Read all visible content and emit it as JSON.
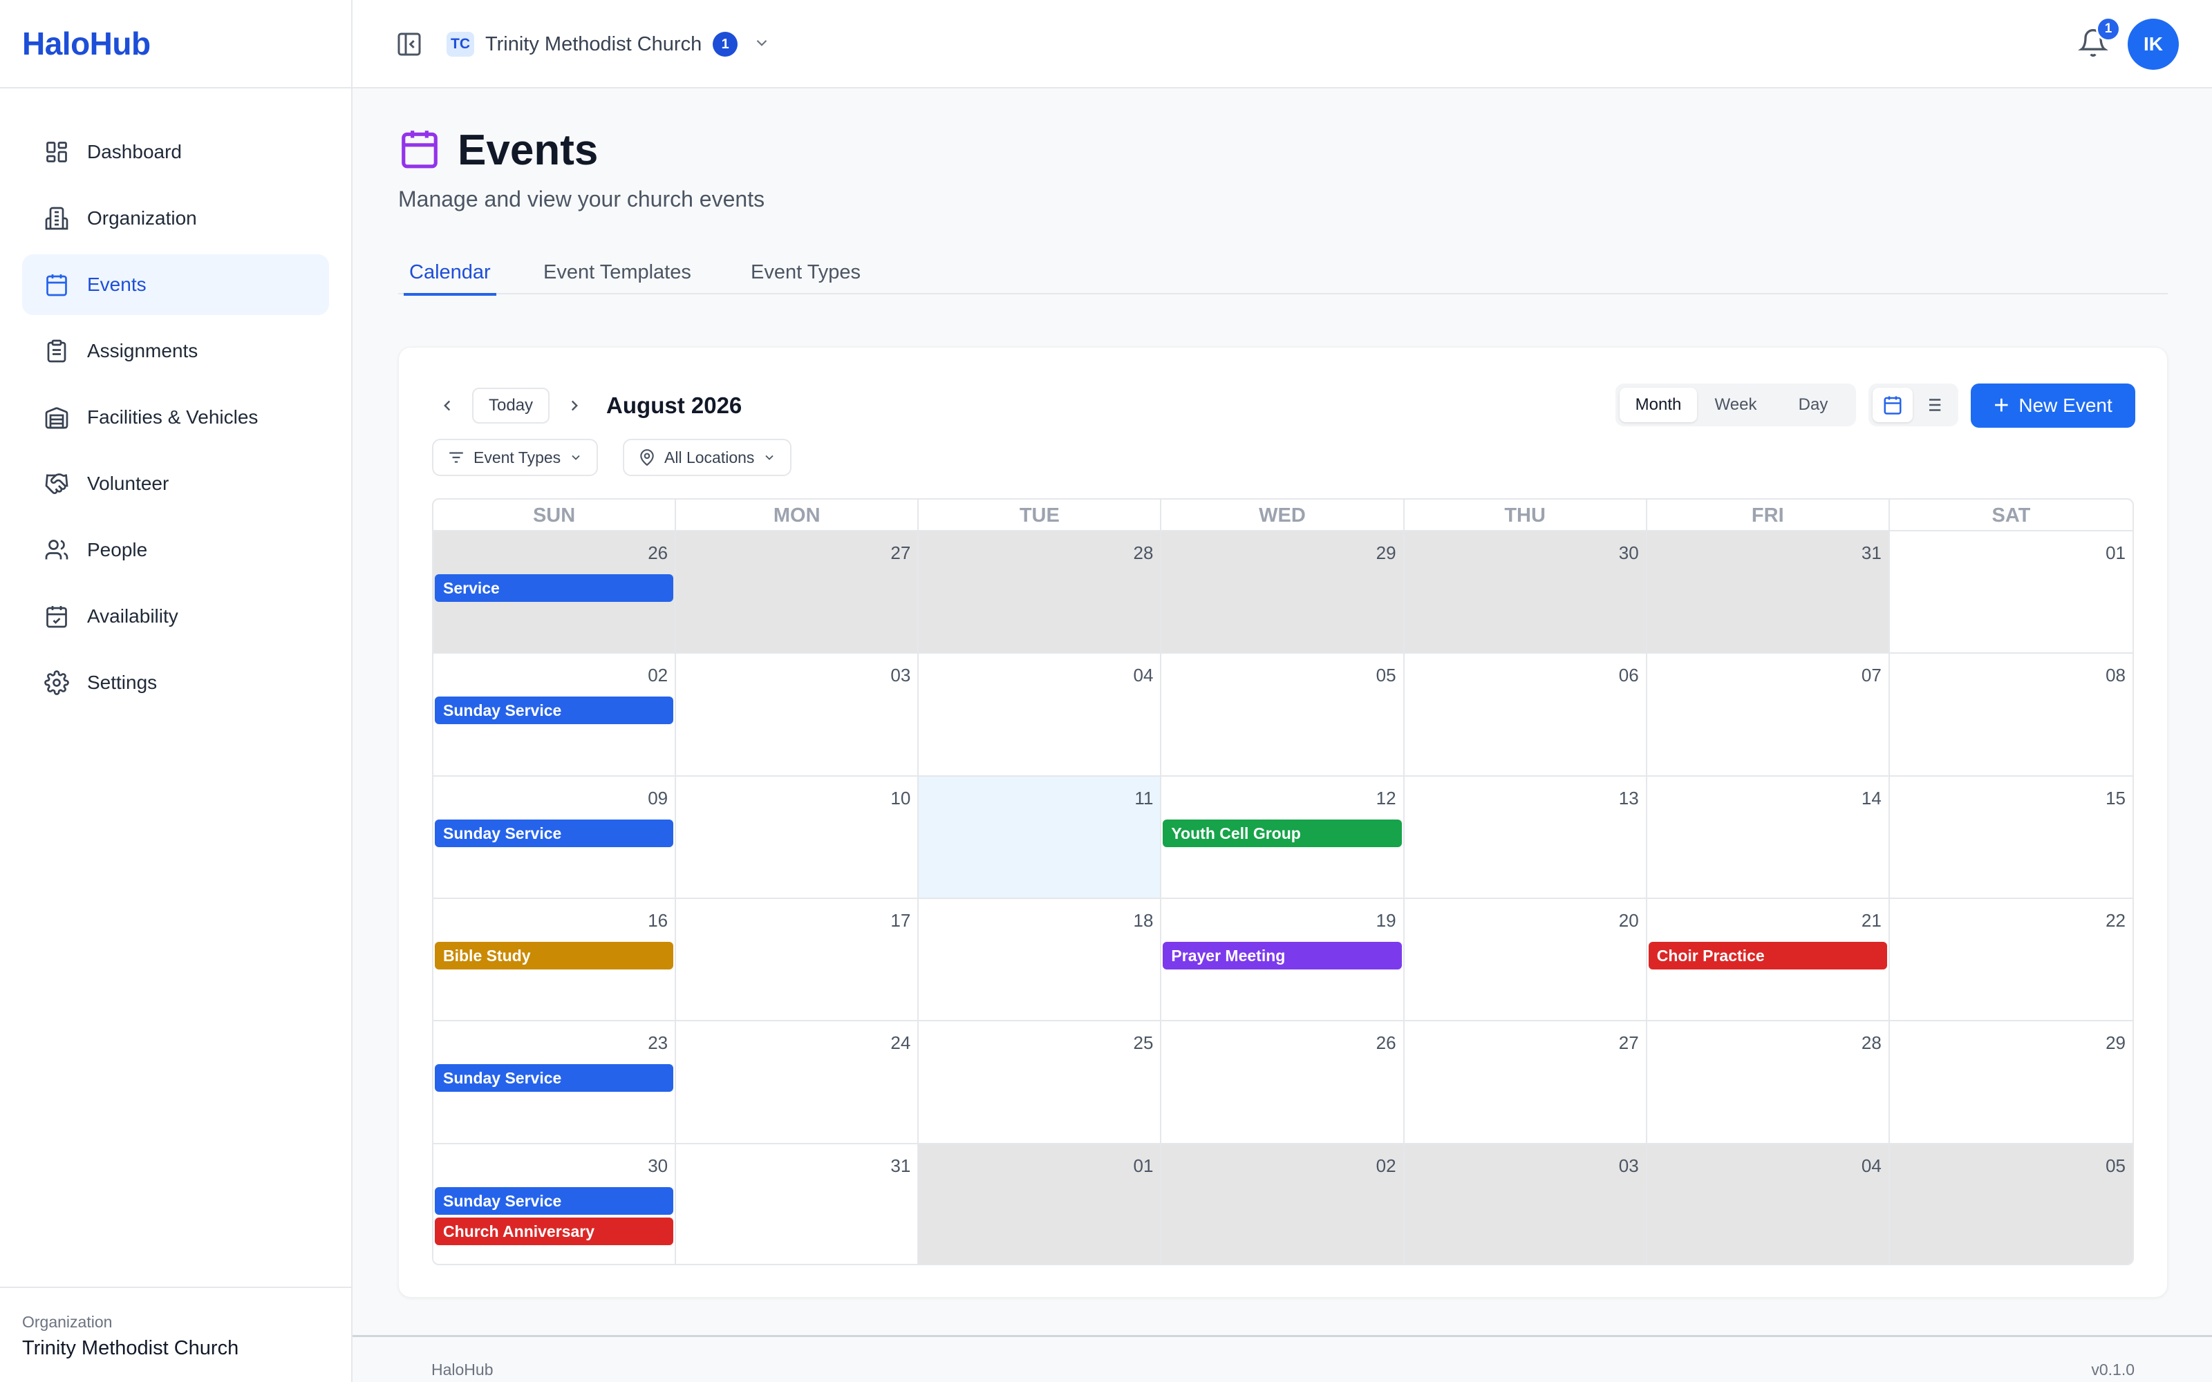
{
  "app": {
    "logo": "HaloHub"
  },
  "sidebar": {
    "items": [
      {
        "label": "Dashboard",
        "icon": "dashboard-icon"
      },
      {
        "label": "Organization",
        "icon": "building-icon"
      },
      {
        "label": "Events",
        "icon": "calendar-icon"
      },
      {
        "label": "Assignments",
        "icon": "clipboard-icon"
      },
      {
        "label": "Facilities & Vehicles",
        "icon": "warehouse-icon"
      },
      {
        "label": "Volunteer",
        "icon": "handshake-icon"
      },
      {
        "label": "People",
        "icon": "users-icon"
      },
      {
        "label": "Availability",
        "icon": "calendar-check-icon"
      },
      {
        "label": "Settings",
        "icon": "gear-icon"
      }
    ],
    "active_index": 2,
    "footer": {
      "label": "Organization",
      "value": "Trinity Methodist Church"
    }
  },
  "topbar": {
    "org_abbr": "TC",
    "org_name": "Trinity Methodist Church",
    "org_count": "1",
    "notification_count": "1",
    "avatar_initials": "IK"
  },
  "page": {
    "title": "Events",
    "subtitle": "Manage and view your church events",
    "tabs": [
      "Calendar",
      "Event Templates",
      "Event Types"
    ],
    "active_tab": 0
  },
  "calendar": {
    "today_label": "Today",
    "month_label": "August 2026",
    "views": [
      "Month",
      "Week",
      "Day"
    ],
    "active_view": "Month",
    "new_event_label": "New Event",
    "filters": {
      "event_types": "Event Types",
      "locations": "All Locations"
    },
    "weekdays": [
      "SUN",
      "MON",
      "TUE",
      "WED",
      "THU",
      "FRI",
      "SAT"
    ],
    "days": [
      {
        "n": "26",
        "other": true
      },
      {
        "n": "27",
        "other": true
      },
      {
        "n": "28",
        "other": true
      },
      {
        "n": "29",
        "other": true
      },
      {
        "n": "30",
        "other": true
      },
      {
        "n": "31",
        "other": true
      },
      {
        "n": "01",
        "other": false
      },
      {
        "n": "02",
        "other": false
      },
      {
        "n": "03",
        "other": false
      },
      {
        "n": "04",
        "other": false
      },
      {
        "n": "05",
        "other": false
      },
      {
        "n": "06",
        "other": false
      },
      {
        "n": "07",
        "other": false
      },
      {
        "n": "08",
        "other": false
      },
      {
        "n": "09",
        "other": false
      },
      {
        "n": "10",
        "other": false
      },
      {
        "n": "11",
        "other": false,
        "today": true
      },
      {
        "n": "12",
        "other": false
      },
      {
        "n": "13",
        "other": false
      },
      {
        "n": "14",
        "other": false
      },
      {
        "n": "15",
        "other": false
      },
      {
        "n": "16",
        "other": false
      },
      {
        "n": "17",
        "other": false
      },
      {
        "n": "18",
        "other": false
      },
      {
        "n": "19",
        "other": false
      },
      {
        "n": "20",
        "other": false
      },
      {
        "n": "21",
        "other": false
      },
      {
        "n": "22",
        "other": false
      },
      {
        "n": "23",
        "other": false
      },
      {
        "n": "24",
        "other": false
      },
      {
        "n": "25",
        "other": false
      },
      {
        "n": "26",
        "other": false
      },
      {
        "n": "27",
        "other": false
      },
      {
        "n": "28",
        "other": false
      },
      {
        "n": "29",
        "other": false
      },
      {
        "n": "30",
        "other": false
      },
      {
        "n": "31",
        "other": false
      },
      {
        "n": "01",
        "other": true
      },
      {
        "n": "02",
        "other": true
      },
      {
        "n": "03",
        "other": true
      },
      {
        "n": "04",
        "other": true
      },
      {
        "n": "05",
        "other": true
      }
    ],
    "events": [
      {
        "cell": 0,
        "title": "Service",
        "color": "#2563eb"
      },
      {
        "cell": 7,
        "title": "Sunday Service",
        "color": "#2563eb"
      },
      {
        "cell": 14,
        "title": "Sunday Service",
        "color": "#2563eb"
      },
      {
        "cell": 17,
        "title": "Youth Cell Group",
        "color": "#16a34a"
      },
      {
        "cell": 21,
        "title": "Bible Study",
        "color": "#ca8a04"
      },
      {
        "cell": 24,
        "title": "Prayer Meeting",
        "color": "#7c3aed"
      },
      {
        "cell": 26,
        "title": "Choir Practice",
        "color": "#dc2626"
      },
      {
        "cell": 28,
        "title": "Sunday Service",
        "color": "#2563eb"
      },
      {
        "cell": 35,
        "title": "Sunday Service",
        "color": "#2563eb"
      },
      {
        "cell": 35,
        "title": "Church Anniversary",
        "color": "#dc2626"
      }
    ]
  },
  "footer": {
    "left": "HaloHub",
    "right": "v0.1.0"
  },
  "colors": {
    "accent": "#1d6bf3",
    "active_bg": "#eff6ff",
    "page_icon": "#9333ea"
  }
}
